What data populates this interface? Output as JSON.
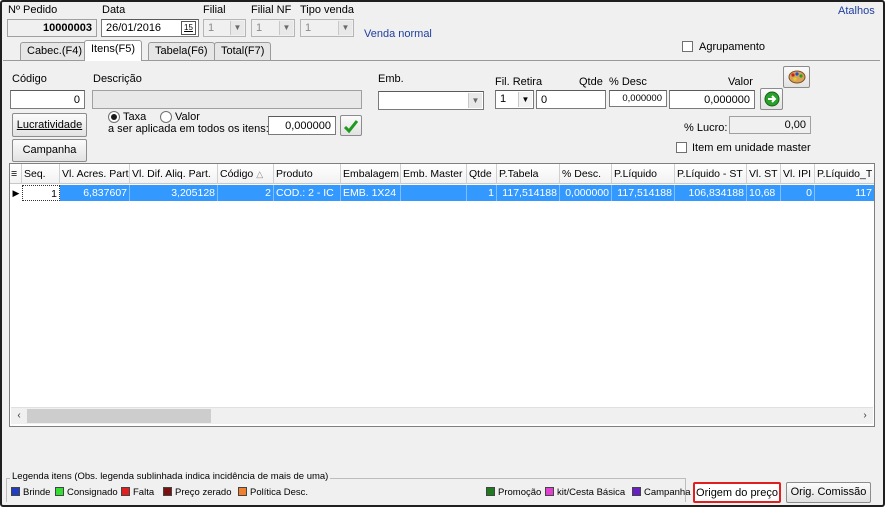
{
  "header": {
    "pedido_label": "Nº Pedido",
    "pedido_value": "10000003",
    "data_label": "Data",
    "data_value": "26/01/2016",
    "calendar_glyph": "15",
    "filial_label": "Filial",
    "filial_value": "1",
    "filialnf_label": "Filial NF",
    "filialnf_value": "1",
    "tipovenda_label": "Tipo venda",
    "tipovenda_value": "1",
    "tipovenda_desc": "Venda normal",
    "atalhos": "Atalhos",
    "agrupamento_label": "Agrupamento"
  },
  "tabs": [
    {
      "label": "Cabec.(F4)"
    },
    {
      "label": "Itens(F5)"
    },
    {
      "label": "Tabela(F6)"
    },
    {
      "label": "Total(F7)"
    }
  ],
  "form": {
    "codigo_label": "Código",
    "codigo_value": "0",
    "descricao_label": "Descrição",
    "descricao_value": "",
    "emb_label": "Emb.",
    "emb_value": "",
    "filretira_label": "Fil. Retira",
    "filretira_value": "1",
    "qtde_label": "Qtde",
    "qtde_value": "0",
    "desc_label": "% Desc",
    "desc_value": "0,000000",
    "valor_label": "Valor",
    "valor_value": "0,000000",
    "lucratividade_button": "Lucratividade",
    "campanha_button": "Campanha",
    "taxa_label": "Taxa",
    "valor_radio_label": "Valor",
    "aplicada_label": "a ser aplicada em todos os itens:",
    "aplicada_value": "0,000000",
    "lucro_label": "% Lucro:",
    "lucro_value": "0,00",
    "item_master_label": "Item em unidade master"
  },
  "grid": {
    "columns": [
      "Seq.",
      "Vl. Acres. Part.",
      "Vl. Dif. Aliq. Part.",
      "Código",
      "Produto",
      "Embalagem",
      "Emb. Master",
      "Qtde",
      "P.Tabela",
      "% Desc.",
      "P.Líquido",
      "P.Líquido - ST",
      "Vl. ST",
      "Vl. IPI",
      "P.Líquido_T"
    ],
    "rows": [
      [
        "1",
        "6,837607",
        "3,205128",
        "2",
        "COD.: 2 - IC",
        "EMB. 1X24",
        "",
        "1",
        "117,514188",
        "0,000000",
        "117,514188",
        "106,834188",
        "10,68",
        "0",
        "117"
      ]
    ]
  },
  "legend": {
    "title": "Legenda itens (Obs. legenda sublinhada indica incidência de mais de uma)",
    "items": [
      {
        "label": "Brinde",
        "color": "#1f3fbf"
      },
      {
        "label": "Consignado",
        "color": "#33dd33"
      },
      {
        "label": "Falta",
        "color": "#e02020"
      },
      {
        "label": "Preço zerado",
        "color": "#7a1010"
      },
      {
        "label": "Política Desc.",
        "color": "#f08030"
      },
      {
        "label": "Promoção",
        "color": "#1f7a1f"
      },
      {
        "label": "kit/Cesta Básica",
        "color": "#e040d0"
      },
      {
        "label": "Campanha",
        "color": "#6a20c0"
      }
    ]
  },
  "footer": {
    "origem_preco_button": "Origem do preço",
    "orig_comissao_button": "Orig. Comissão"
  },
  "colors": {
    "accent": "#3399ff",
    "highlight_border": "#e02020",
    "link": "#1f3fa0"
  }
}
